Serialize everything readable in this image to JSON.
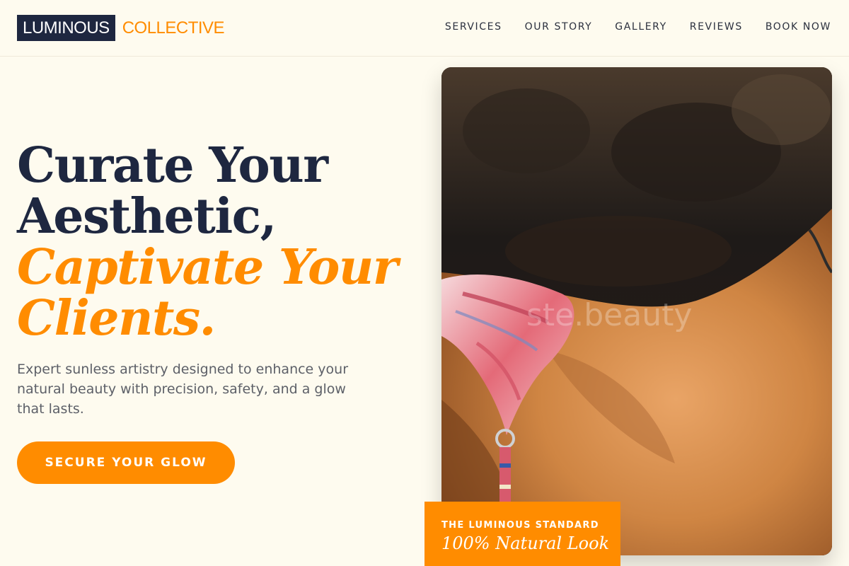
{
  "brand": {
    "name": "LUMINOUS",
    "accent": "COLLECTIVE"
  },
  "nav": {
    "items": [
      {
        "label": "SERVICES"
      },
      {
        "label": "OUR STORY"
      },
      {
        "label": "GALLERY"
      },
      {
        "label": "REVIEWS"
      },
      {
        "label": "BOOK NOW"
      }
    ]
  },
  "hero": {
    "headline_line1": "Curate Your",
    "headline_line2": "Aesthetic,",
    "headline_accent1": "Captivate Your",
    "headline_accent2": "Clients.",
    "subtitle": "Expert sunless artistry designed to enhance your natural beauty with precision, safety, and a glow that lasts.",
    "cta_label": "SECURE YOUR GLOW"
  },
  "photo": {
    "watermark": "ste.beauty",
    "description_icon": "photo-tanned-skin-bikini"
  },
  "badge": {
    "label": "THE LUMINOUS STANDARD",
    "value": "100% Natural Look"
  },
  "colors": {
    "background": "#fefbef",
    "navy": "#1e2740",
    "accent": "#ff8c00",
    "text_muted": "#5d6068"
  }
}
